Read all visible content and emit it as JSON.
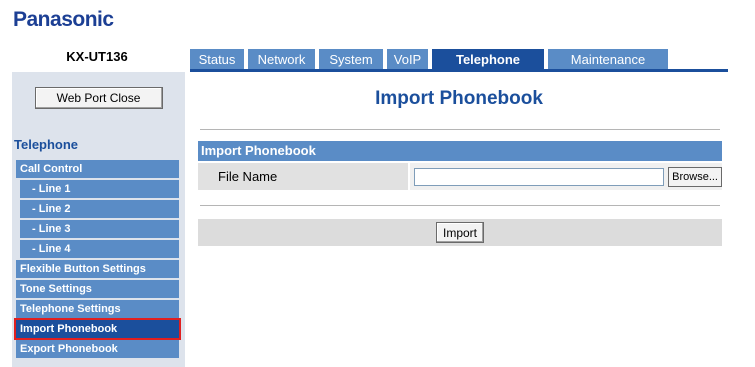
{
  "brand": {
    "logo": "Panasonic",
    "model": "KX-UT136"
  },
  "tabs": [
    {
      "label": "Status"
    },
    {
      "label": "Network"
    },
    {
      "label": "System"
    },
    {
      "label": "VoIP"
    },
    {
      "label": "Telephone",
      "active": true
    },
    {
      "label": "Maintenance"
    }
  ],
  "sidebar": {
    "web_port_close": "Web Port Close",
    "title": "Telephone",
    "items": [
      {
        "label": "Call Control"
      },
      {
        "label": "- Line 1"
      },
      {
        "label": "- Line 2"
      },
      {
        "label": "- Line 3"
      },
      {
        "label": "- Line 4"
      },
      {
        "label": "Flexible Button Settings"
      },
      {
        "label": "Tone Settings"
      },
      {
        "label": "Telephone Settings"
      },
      {
        "label": "Import Phonebook",
        "active": true
      },
      {
        "label": "Export Phonebook"
      }
    ]
  },
  "main": {
    "title": "Import Phonebook",
    "section_title": "Import Phonebook",
    "file_label": "File Name",
    "file_value": "",
    "browse_label": "Browse...",
    "import_label": "Import"
  },
  "colors": {
    "brand": "#1c3f94",
    "tab": "#5a8cc6",
    "tab_active": "#1b4f9c",
    "highlight": "#e02020"
  }
}
